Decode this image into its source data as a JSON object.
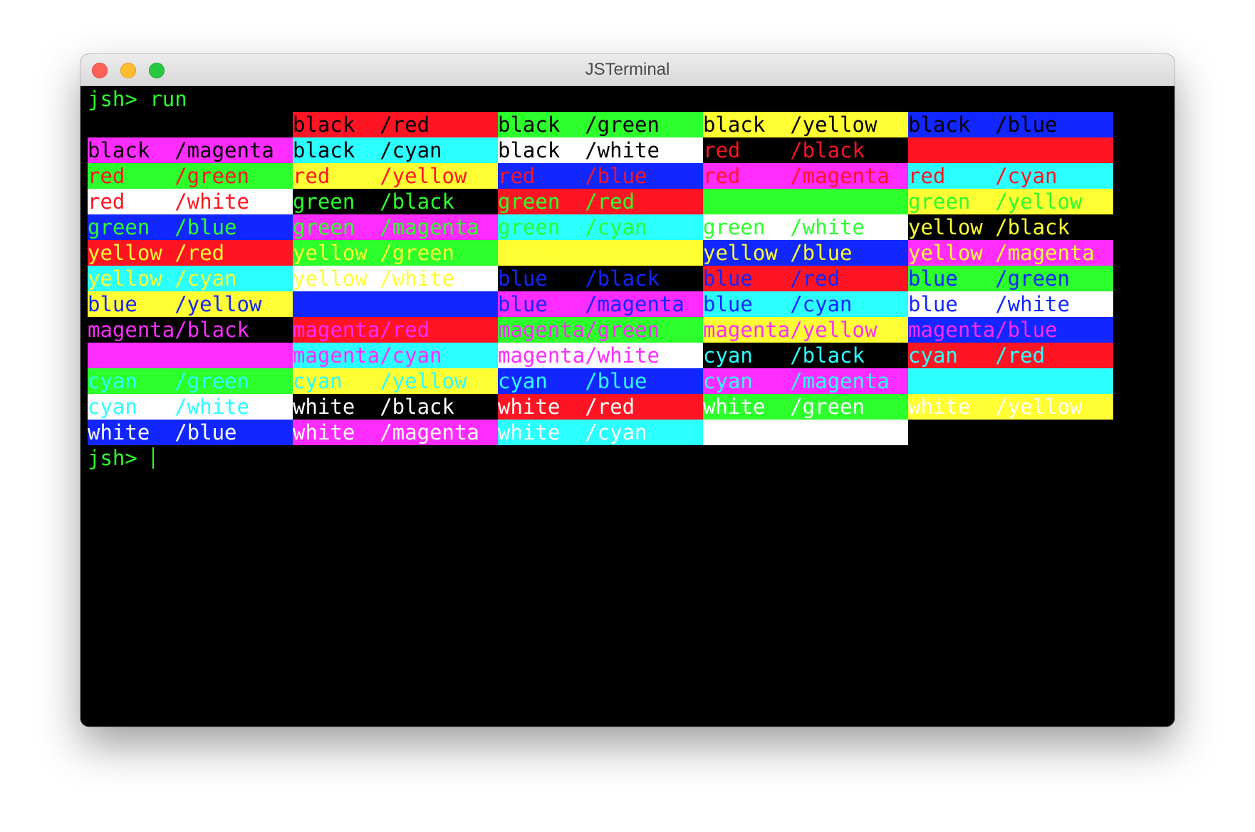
{
  "window": {
    "title": "JSTerminal"
  },
  "colors": {
    "black": "#000000",
    "red": "#ff1423",
    "green": "#2cff2c",
    "yellow": "#ffff33",
    "blue": "#1226ff",
    "magenta": "#ff2cff",
    "cyan": "#2cffff",
    "white": "#ffffff"
  },
  "terminal": {
    "prompt": "jsh> ",
    "command": "run",
    "color_names": [
      "black",
      "red",
      "green",
      "yellow",
      "blue",
      "magenta",
      "cyan",
      "white"
    ],
    "separator": "/",
    "cells_per_row": 5
  }
}
